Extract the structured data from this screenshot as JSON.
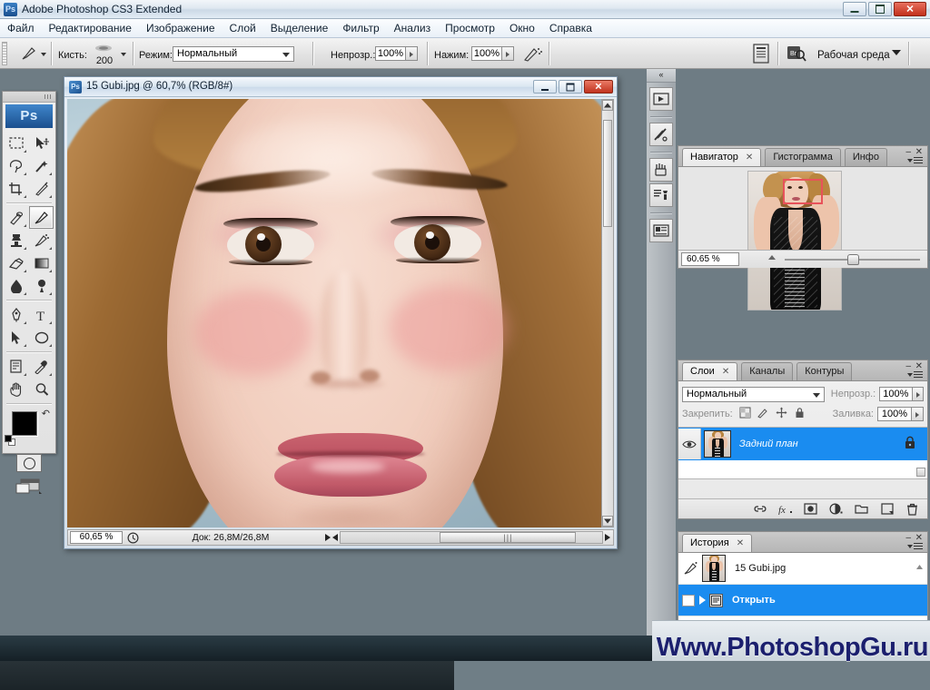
{
  "window": {
    "title": "Adobe Photoshop CS3 Extended",
    "app_badge": "Ps",
    "minimize": "–",
    "maximize": "❐",
    "close": "✕"
  },
  "menubar": {
    "items": [
      {
        "label": "Файл"
      },
      {
        "label": "Редактирование"
      },
      {
        "label": "Изображение"
      },
      {
        "label": "Слой"
      },
      {
        "label": "Выделение"
      },
      {
        "label": "Фильтр"
      },
      {
        "label": "Анализ"
      },
      {
        "label": "Просмотр"
      },
      {
        "label": "Окно"
      },
      {
        "label": "Справка"
      }
    ]
  },
  "options_bar": {
    "tool_icon": "brush-tool-icon",
    "brush_label": "Кисть:",
    "brush_size": "200",
    "mode_label": "Режим:",
    "mode_value": "Нормальный",
    "opacity_label": "Непрозр.:",
    "opacity_value": "100%",
    "flow_label": "Нажим:",
    "flow_value": "100%",
    "airbrush_icon": "airbrush-icon",
    "palettes_icon": "palettes-toggle-icon",
    "bridge_icon": "go-to-bridge-icon",
    "workspace_label": "Рабочая среда"
  },
  "toolbox": {
    "badge": "Ps",
    "tools": [
      {
        "name": "marquee-tool",
        "row": 0,
        "col": 0,
        "active": false
      },
      {
        "name": "move-tool",
        "row": 0,
        "col": 1,
        "active": false
      },
      {
        "name": "lasso-tool",
        "row": 1,
        "col": 0,
        "active": false
      },
      {
        "name": "magic-wand-tool",
        "row": 1,
        "col": 1,
        "active": false
      },
      {
        "name": "crop-tool",
        "row": 2,
        "col": 0,
        "active": false
      },
      {
        "name": "slice-tool",
        "row": 2,
        "col": 1,
        "active": false
      },
      {
        "name": "healing-brush-tool",
        "row": 3,
        "col": 0,
        "active": false
      },
      {
        "name": "brush-tool",
        "row": 3,
        "col": 1,
        "active": true
      },
      {
        "name": "clone-stamp-tool",
        "row": 4,
        "col": 0,
        "active": false
      },
      {
        "name": "history-brush-tool",
        "row": 4,
        "col": 1,
        "active": false
      },
      {
        "name": "eraser-tool",
        "row": 5,
        "col": 0,
        "active": false
      },
      {
        "name": "gradient-tool",
        "row": 5,
        "col": 1,
        "active": false
      },
      {
        "name": "blur-tool",
        "row": 6,
        "col": 0,
        "active": false
      },
      {
        "name": "dodge-tool",
        "row": 6,
        "col": 1,
        "active": false
      },
      {
        "name": "pen-tool",
        "row": 7,
        "col": 0,
        "active": false
      },
      {
        "name": "type-tool",
        "row": 7,
        "col": 1,
        "active": false
      },
      {
        "name": "path-selection-tool",
        "row": 8,
        "col": 0,
        "active": false
      },
      {
        "name": "shape-tool",
        "row": 8,
        "col": 1,
        "active": false
      },
      {
        "name": "notes-tool",
        "row": 9,
        "col": 0,
        "active": false
      },
      {
        "name": "eyedropper-tool",
        "row": 9,
        "col": 1,
        "active": false
      },
      {
        "name": "hand-tool",
        "row": 10,
        "col": 0,
        "active": false
      },
      {
        "name": "zoom-tool",
        "row": 10,
        "col": 1,
        "active": false
      }
    ],
    "foreground_color": "#000000",
    "background_color": "#ffffff"
  },
  "document": {
    "icon": "Ps",
    "title": "15 Gubi.jpg @ 60,7% (RGB/8#)",
    "status_zoom": "60,65 %",
    "status_doc": "Док: 26,8M/26,8M"
  },
  "dock": {
    "collapse_label": "«",
    "buttons": [
      {
        "name": "animation-panel-icon"
      },
      {
        "name": "tool-presets-panel-icon"
      },
      {
        "name": "brushes-panel-icon"
      },
      {
        "name": "clone-source-panel-icon"
      },
      {
        "name": "layer-comps-panel-icon"
      }
    ]
  },
  "navigator": {
    "tabs": [
      {
        "label": "Навигатор",
        "active": true,
        "closable": true
      },
      {
        "label": "Гистограмма",
        "active": false,
        "closable": false
      },
      {
        "label": "Инфо",
        "active": false,
        "closable": false
      }
    ],
    "zoom_value": "60.65 %",
    "zoom_out_icon": "zoom-out-icon",
    "zoom_in_icon": "zoom-in-icon",
    "view_box_color": "#e8525a"
  },
  "layers": {
    "tabs": [
      {
        "label": "Слои",
        "active": true,
        "closable": true
      },
      {
        "label": "Каналы",
        "active": false,
        "closable": false
      },
      {
        "label": "Контуры",
        "active": false,
        "closable": false
      }
    ],
    "blend_mode": "Нормальный",
    "opacity_label": "Непрозр.:",
    "opacity_value": "100%",
    "lock_label": "Закрепить:",
    "lock_icons": [
      "lock-transparency-icon",
      "lock-image-icon",
      "lock-position-icon",
      "lock-all-icon"
    ],
    "fill_label": "Заливка:",
    "fill_value": "100%",
    "items": [
      {
        "name": "Задний план",
        "visible": true,
        "locked": true,
        "selected": true
      }
    ],
    "footer_buttons": [
      {
        "name": "link-layers-icon"
      },
      {
        "name": "layer-style-fx-icon"
      },
      {
        "name": "add-layer-mask-icon"
      },
      {
        "name": "new-adjustment-layer-icon"
      },
      {
        "name": "new-group-icon"
      },
      {
        "name": "new-layer-icon"
      },
      {
        "name": "delete-layer-icon"
      }
    ]
  },
  "history": {
    "tabs": [
      {
        "label": "История",
        "active": true,
        "closable": true
      }
    ],
    "snapshot": "15 Gubi.jpg",
    "states": [
      {
        "label": "Открыть",
        "selected": true
      }
    ]
  },
  "watermark": {
    "text": "Www.PhotoshopGu.ru",
    "color": "#1b1f6e"
  }
}
